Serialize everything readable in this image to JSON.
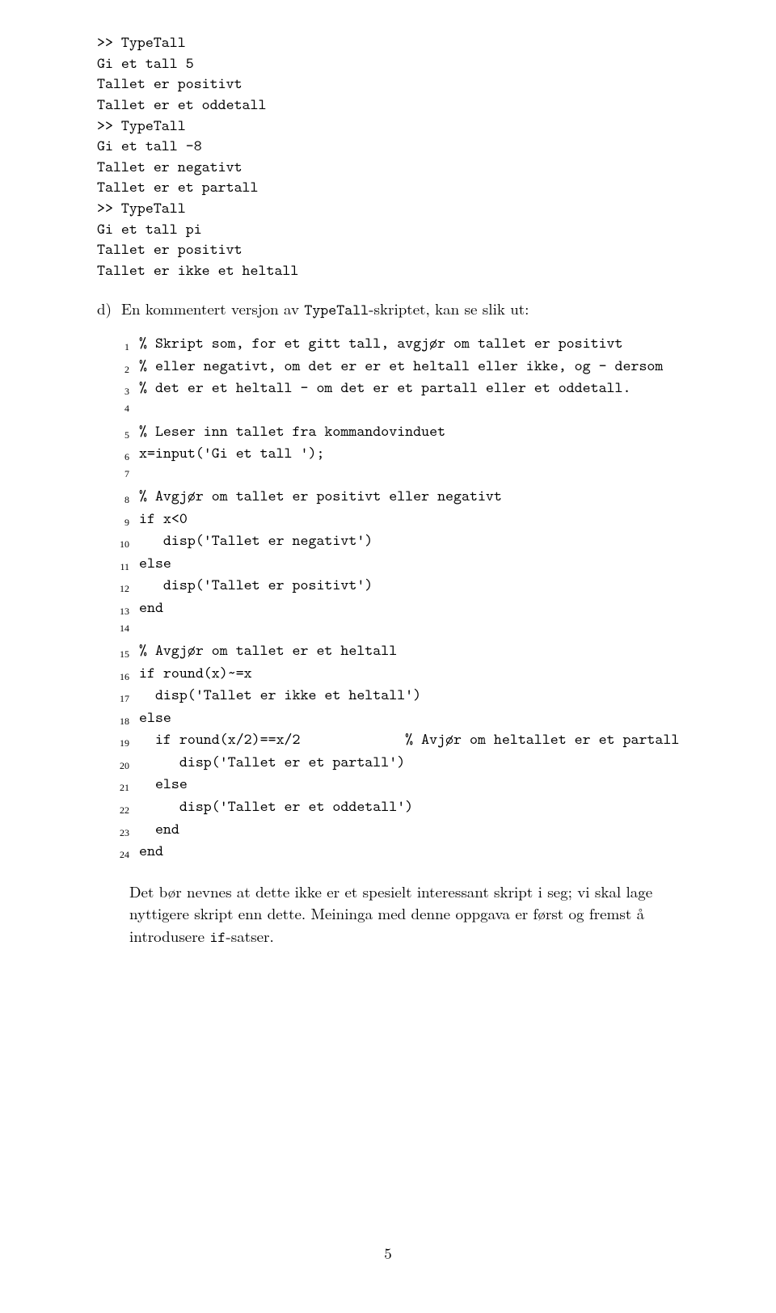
{
  "session": {
    "lines": [
      ">> TypeTall",
      "Gi et tall 5",
      "Tallet er positivt",
      "Tallet er et oddetall",
      ">> TypeTall",
      "Gi et tall -8",
      "Tallet er negativt",
      "Tallet er et partall",
      ">> TypeTall",
      "Gi et tall pi",
      "Tallet er positivt",
      "Tallet er ikke et heltall"
    ]
  },
  "item_d": {
    "label": "d)",
    "text_before": "En kommentert versjon av ",
    "tt": "TypeTall",
    "text_after": "-skriptet, kan se slik ut:"
  },
  "code": {
    "lines": [
      "% Skript som, for et gitt tall, avgjør om tallet er positivt",
      "% eller negativt, om det er er et heltall eller ikke, og - dersom",
      "% det er et heltall - om det er et partall eller et oddetall.",
      "",
      "% Leser inn tallet fra kommandovinduet",
      "x=input('Gi et tall ');",
      "",
      "% Avgjør om tallet er positivt eller negativt",
      "if x<0",
      "   disp('Tallet er negativt')",
      "else",
      "   disp('Tallet er positivt')",
      "end",
      "",
      "% Avgjør om tallet er et heltall",
      "if round(x)~=x",
      "  disp('Tallet er ikke et heltall')",
      "else",
      "  if round(x/2)==x/2             % Avjør om heltallet er et partall",
      "     disp('Tallet er et partall')",
      "  else",
      "     disp('Tallet er et oddetall')",
      "  end",
      "end"
    ]
  },
  "closing": {
    "text_before": "Det bør nevnes at dette ikke er et spesielt interessant skript i seg; vi skal lage nyttigere skript enn dette. Meininga med denne oppgava er først og fremst å introdusere ",
    "tt": "if",
    "text_after": "-satser."
  },
  "pagenum": "5"
}
